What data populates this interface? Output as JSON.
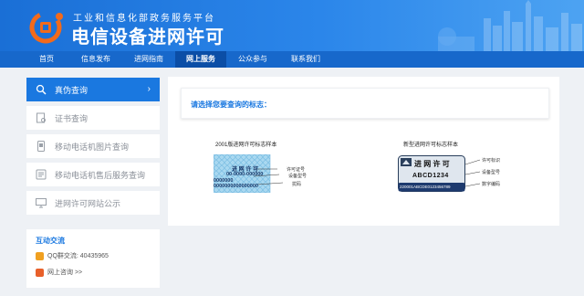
{
  "header": {
    "platform_name": "工业和信息化部政务服务平台",
    "site_title": "电信设备进网许可"
  },
  "nav": {
    "items": [
      "首页",
      "信息发布",
      "进网指南",
      "网上服务",
      "公众参与",
      "联系我们"
    ],
    "active": "网上服务"
  },
  "sidebar": {
    "items": [
      {
        "label": "真伪查询",
        "icon": "search-icon",
        "active": true
      },
      {
        "label": "证书查询",
        "icon": "certificate-icon"
      },
      {
        "label": "移动电话机图片查询",
        "icon": "phone-image-icon"
      },
      {
        "label": "移动电话机售后服务查询",
        "icon": "phone-service-icon"
      },
      {
        "label": "进网许可网站公示",
        "icon": "computer-icon"
      }
    ],
    "active_chevron": "›"
  },
  "contact": {
    "title": "互动交流",
    "qq": "QQ群交流: 40435965",
    "online": "网上咨询 >>"
  },
  "main": {
    "prompt": "请选择您要查询的标志：",
    "old_caption": "2001版进网许可标志样本",
    "new_caption": "新型进网许可标志样本",
    "old_label": {
      "title": "进 网 许 可",
      "line1": "00-0000-000000",
      "line2": "0000000",
      "line3": "0000000000000000",
      "pointer1": "许可证号",
      "pointer2": "设备型号",
      "pointer3": "扰码"
    },
    "new_label": {
      "title": "进 网 许 可",
      "model": "ABCD1234",
      "code": "220001ABCDE0123456789",
      "pointer1": "许可标识",
      "pointer2": "设备型号",
      "pointer3": "数字编码"
    }
  },
  "colors": {
    "brand_blue": "#1a78e0",
    "nav_blue": "#1768cb",
    "nav_active": "#0b4ea6",
    "logo_orange": "#f26a1b"
  }
}
